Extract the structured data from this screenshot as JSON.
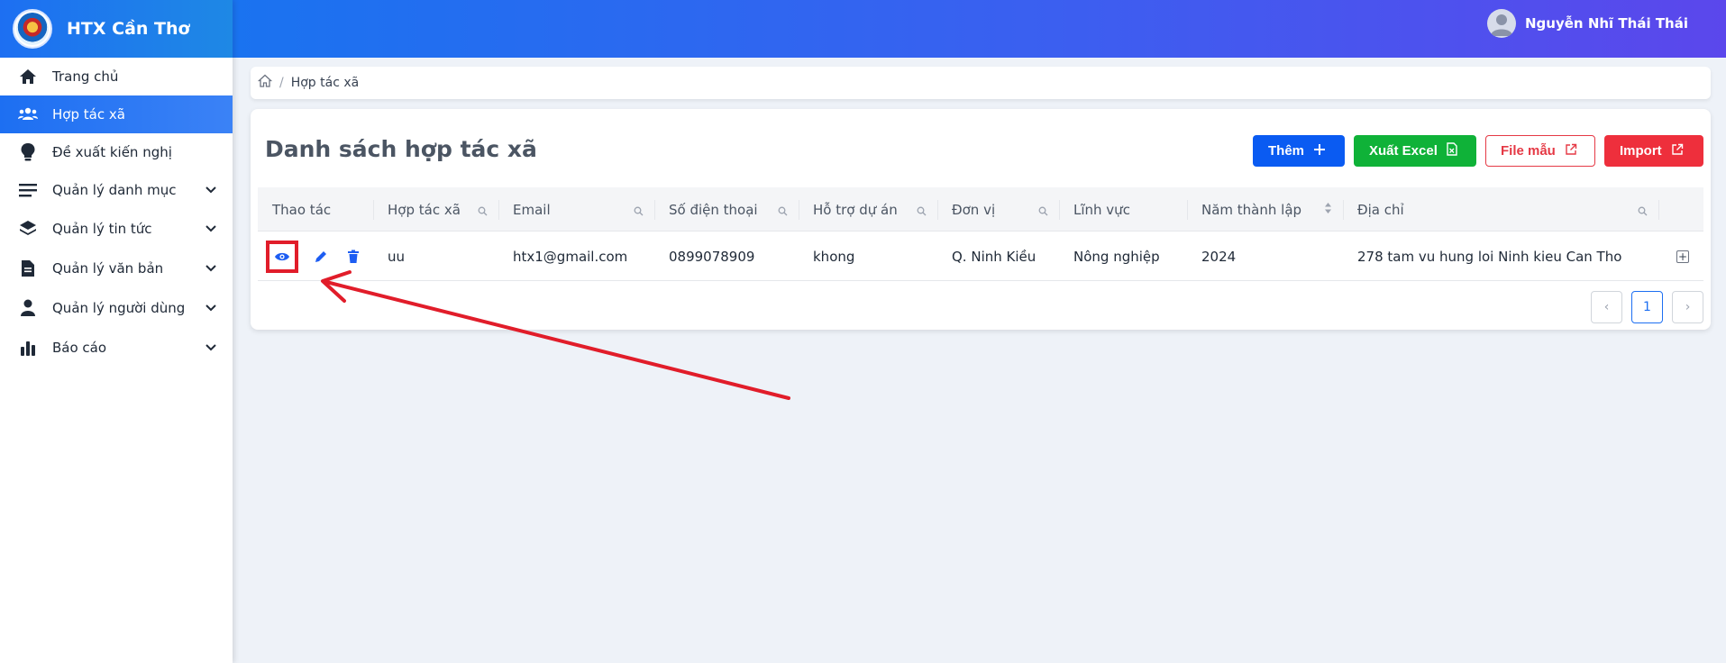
{
  "brand": {
    "name": "HTX Cần Thơ"
  },
  "user": {
    "name": "Nguyễn Nhĩ Thái Thái"
  },
  "sidebar": {
    "items": [
      {
        "label": "Trang chủ",
        "icon": "home-icon",
        "active": false,
        "expandable": false
      },
      {
        "label": "Hợp tác xã",
        "icon": "users-icon",
        "active": true,
        "expandable": false
      },
      {
        "label": "Đề xuất kiến nghị",
        "icon": "lightbulb-icon",
        "active": false,
        "expandable": false
      },
      {
        "label": "Quản lý danh mục",
        "icon": "menu-lines-icon",
        "active": false,
        "expandable": true
      },
      {
        "label": "Quản lý tin tức",
        "icon": "layers-icon",
        "active": false,
        "expandable": true
      },
      {
        "label": "Quản lý văn bản",
        "icon": "document-icon",
        "active": false,
        "expandable": true
      },
      {
        "label": "Quản lý người dùng",
        "icon": "person-icon",
        "active": false,
        "expandable": true
      },
      {
        "label": "Báo cáo",
        "icon": "bar-chart-icon",
        "active": false,
        "expandable": true
      }
    ]
  },
  "breadcrumb": {
    "current": "Hợp tác xã",
    "separator": "/"
  },
  "page": {
    "title": "Danh sách hợp tác xã"
  },
  "actions": {
    "add": "Thêm",
    "export": "Xuất Excel",
    "template": "File mẫu",
    "import": "Import"
  },
  "table": {
    "columns": [
      {
        "label": "Thao tác",
        "icon": ""
      },
      {
        "label": "Hợp tác xã",
        "icon": "search-icon"
      },
      {
        "label": "Email",
        "icon": "search-icon"
      },
      {
        "label": "Số điện thoại",
        "icon": "search-icon"
      },
      {
        "label": "Hỗ trợ dự án",
        "icon": "search-icon"
      },
      {
        "label": "Đơn vị",
        "icon": "search-icon"
      },
      {
        "label": "Lĩnh vực",
        "icon": ""
      },
      {
        "label": "Năm thành lập",
        "icon": "sort-icon"
      },
      {
        "label": "Địa chỉ",
        "icon": "search-icon"
      },
      {
        "label": "",
        "icon": ""
      }
    ],
    "rows": [
      {
        "name": "uu",
        "email": "htx1@gmail.com",
        "phone": "0899078909",
        "support": "khong",
        "unit": "Q. Ninh Kiều",
        "field": "Nông nghiệp",
        "year": "2024",
        "address": "278 tam vu hung loi Ninh kieu Can Tho"
      }
    ]
  },
  "pagination": {
    "prev": "‹",
    "current": "1",
    "next": "›"
  },
  "colors": {
    "accent": "#1d6ff2",
    "success": "#0fb238",
    "danger": "#ee2f3c",
    "annotation": "#e11d2a"
  }
}
